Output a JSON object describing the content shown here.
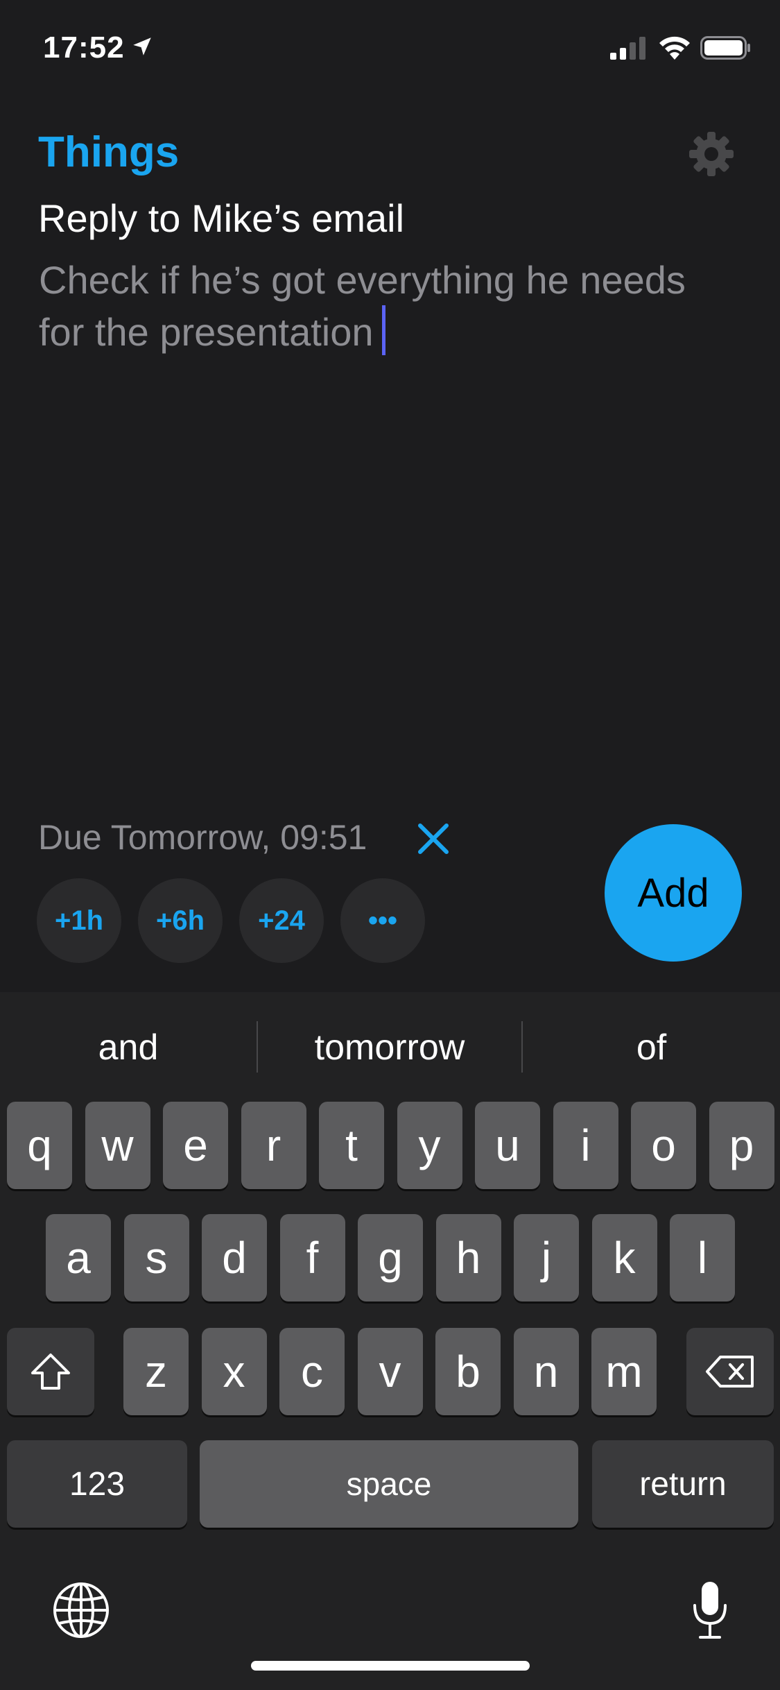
{
  "status_bar": {
    "time": "17:52"
  },
  "header": {
    "app_title": "Things"
  },
  "task": {
    "title": "Reply to Mike’s email",
    "notes": "Check if he’s got everything he needs for the presentation"
  },
  "due": {
    "label": "Due Tomorrow, 09:51",
    "quick_buttons": [
      "+1h",
      "+6h",
      "+24",
      "•••"
    ]
  },
  "add_button": {
    "label": "Add"
  },
  "keyboard": {
    "suggestions": [
      "and",
      "tomorrow",
      "of"
    ],
    "row1": [
      "q",
      "w",
      "e",
      "r",
      "t",
      "y",
      "u",
      "i",
      "o",
      "p"
    ],
    "row2": [
      "a",
      "s",
      "d",
      "f",
      "g",
      "h",
      "j",
      "k",
      "l"
    ],
    "row3": [
      "z",
      "x",
      "c",
      "v",
      "b",
      "n",
      "m"
    ],
    "numbers_label": "123",
    "space_label": "space",
    "return_label": "return"
  },
  "colors": {
    "accent": "#1aa5f0",
    "background": "#1c1c1e",
    "cursor": "#5b63f5"
  },
  "icons": [
    "location-arrow-icon",
    "signal-icon",
    "wifi-icon",
    "battery-icon",
    "gear-icon",
    "close-icon",
    "shift-icon",
    "backspace-icon",
    "globe-icon",
    "microphone-icon"
  ]
}
